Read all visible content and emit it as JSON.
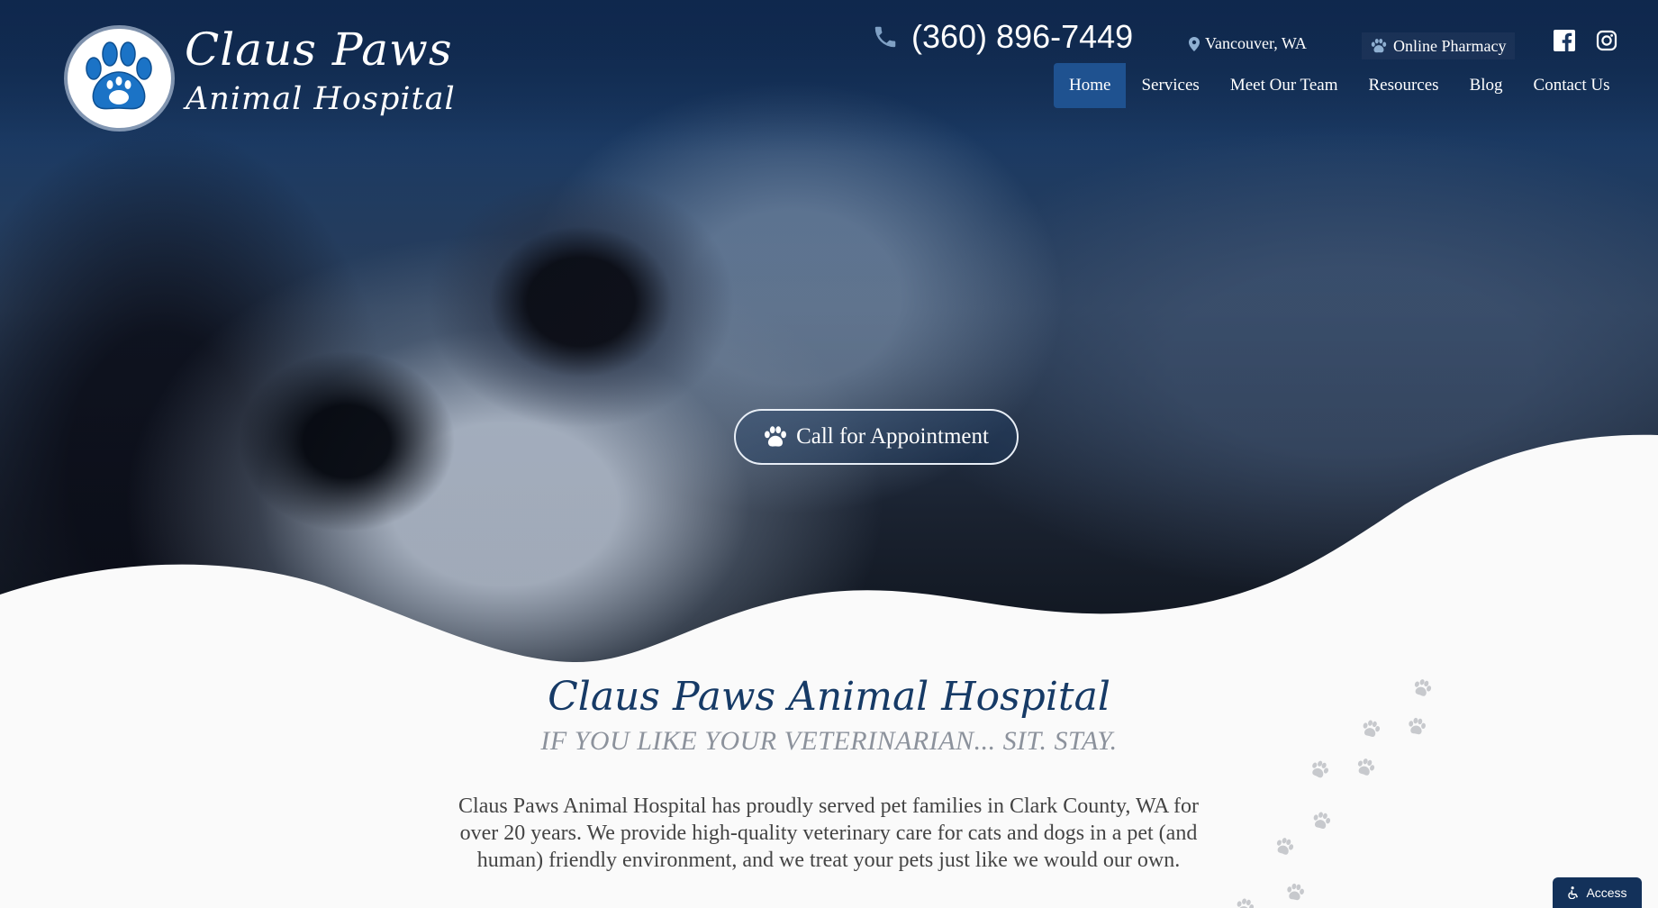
{
  "brand": {
    "name_line1": "Claus Paws",
    "name_line2": "Animal Hospital"
  },
  "header": {
    "phone": "(360) 896-7449",
    "location": "Vancouver, WA",
    "pharmacy_label": "Online Pharmacy",
    "social": [
      "facebook-icon",
      "instagram-icon"
    ]
  },
  "nav": {
    "items": [
      {
        "label": "Home",
        "active": true
      },
      {
        "label": "Services"
      },
      {
        "label": "Meet Our Team"
      },
      {
        "label": "Resources"
      },
      {
        "label": "Blog"
      },
      {
        "label": "Contact Us"
      }
    ]
  },
  "hero": {
    "cta_label": "Call for Appointment"
  },
  "main": {
    "title": "Claus Paws Animal Hospital",
    "subtitle": "IF YOU LIKE YOUR VETERINARIAN... SIT. STAY.",
    "intro": "Claus Paws Animal Hospital has proudly served pet families in Clark County, WA for over 20 years. We provide high-quality veterinary care for cats and dogs in a pet (and human) friendly environment, and we treat your pets just like we would our own."
  },
  "accessibility": {
    "label": "Access"
  },
  "colors": {
    "brand_blue": "#1f5290",
    "title_blue": "#163a66",
    "subtitle_gray": "#8c929c",
    "paw_blue": "#1b73c6"
  }
}
